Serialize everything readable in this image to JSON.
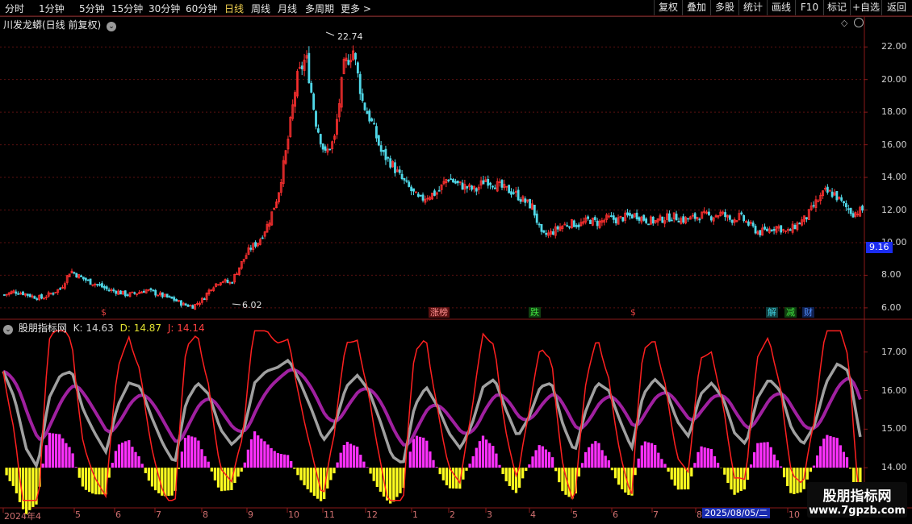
{
  "toolbar": {
    "periods": [
      "分时",
      "1分钟",
      "5分钟",
      "15分钟",
      "30分钟",
      "60分钟",
      "日线",
      "周线",
      "月线",
      "多周期",
      "更多 >"
    ],
    "active": "日线",
    "right_buttons": [
      "复权",
      "叠加",
      "多股",
      "统计",
      "画线",
      "F10",
      "标记",
      "+自选",
      "返回"
    ]
  },
  "main": {
    "title": "川发龙蟒(日线 前复权)",
    "high_label": "22.74",
    "low_label": "6.02",
    "last_price": "9.16",
    "yticks": [
      "22.00",
      "20.00",
      "18.00",
      "16.00",
      "14.00",
      "12.00",
      "10.00",
      "8.00",
      "6.00"
    ],
    "events": [
      {
        "text": "$",
        "color": "#e04040"
      },
      {
        "text": "涨榜",
        "color": "#e06060"
      },
      {
        "text": "跌",
        "color": "#40d040"
      },
      {
        "text": "$",
        "color": "#e04040"
      },
      {
        "text": "解",
        "color": "#40c0d0"
      },
      {
        "text": "减",
        "color": "#40d040"
      },
      {
        "text": "财",
        "color": "#4080ff"
      }
    ]
  },
  "indicator": {
    "name": "股朋指标网",
    "k_label": "K: 14.63",
    "d_label": "D: 14.87",
    "j_label": "J: 14.14",
    "yticks": [
      "17.00",
      "16.00",
      "15.00",
      "14.00"
    ]
  },
  "xaxis": {
    "labels": [
      "2024年4",
      "5",
      "6",
      "7",
      "8",
      "9",
      "10",
      "11",
      "12",
      "1",
      "2",
      "3",
      "4",
      "5",
      "6",
      "7",
      "8",
      "9",
      "10"
    ],
    "cursor_date": "2025/08/05/二"
  },
  "watermark": {
    "line1": "股朋指标网",
    "line2": "www.7gpzb.com"
  },
  "colors": {
    "up": "#ff3030",
    "down": "#50d8e8",
    "k": "#a0a0a0",
    "d": "#a020a0",
    "j": "#ff2020",
    "bar_pos": "#ff30ff",
    "bar_neg": "#ffff20"
  },
  "chart_data": {
    "type": "candlestick",
    "price_close": [
      6.8,
      7.0,
      6.9,
      6.7,
      6.6,
      6.9,
      7.2,
      8.3,
      7.9,
      7.6,
      7.4,
      7.1,
      7.0,
      6.8,
      6.9,
      7.1,
      6.9,
      6.7,
      6.5,
      6.2,
      6.1,
      6.5,
      7.3,
      7.7,
      7.5,
      8.6,
      9.6,
      10.1,
      11.2,
      12.9,
      16.0,
      20.0,
      21.4,
      17.5,
      15.4,
      16.3,
      20.8,
      21.8,
      18.6,
      17.3,
      15.5,
      14.9,
      14.0,
      13.3,
      12.6,
      12.9,
      13.1,
      14.0,
      13.6,
      13.4,
      13.2,
      13.9,
      13.6,
      13.3,
      13.1,
      12.6,
      12.2,
      10.4,
      10.6,
      11.0,
      11.2,
      11.1,
      11.4,
      11.2,
      11.5,
      11.4,
      11.6,
      11.7,
      11.4,
      11.3,
      11.5,
      11.6,
      11.4,
      11.5,
      11.7,
      11.6,
      11.8,
      11.4,
      11.6,
      11.1,
      10.6,
      10.8,
      11.0,
      10.6,
      11.1,
      11.5,
      12.4,
      13.1,
      13.0,
      12.3,
      11.8,
      12.0
    ],
    "k_values": [
      16.5,
      15.8,
      14.5,
      14.0,
      15.8,
      16.4,
      16.5,
      15.5,
      14.9,
      14.4,
      15.6,
      16.2,
      16.1,
      15.3,
      14.6,
      14.1,
      15.7,
      16.2,
      15.9,
      15.0,
      14.6,
      14.9,
      16.2,
      16.5,
      16.6,
      16.8,
      16.2,
      15.5,
      14.7,
      15.1,
      16.1,
      16.4,
      16.0,
      15.2,
      14.3,
      14.1,
      15.6,
      16.1,
      15.6,
      14.9,
      14.5,
      15.1,
      16.1,
      16.3,
      15.5,
      14.8,
      15.3,
      16.1,
      16.2,
      15.1,
      14.4,
      15.5,
      16.2,
      16.0,
      15.2,
      14.5,
      15.9,
      16.3,
      16.0,
      15.2,
      14.8,
      15.9,
      16.2,
      15.8,
      14.9,
      14.6,
      15.8,
      16.3,
      16.0,
      15.0,
      14.6,
      15.1,
      16.2,
      16.7,
      16.5,
      14.8
    ],
    "x_month_labels": [
      "2024年4",
      "5",
      "6",
      "7",
      "8",
      "9",
      "10",
      "11",
      "12",
      "1",
      "2",
      "3",
      "4",
      "5",
      "6",
      "7",
      "8",
      "9",
      "10"
    ]
  }
}
